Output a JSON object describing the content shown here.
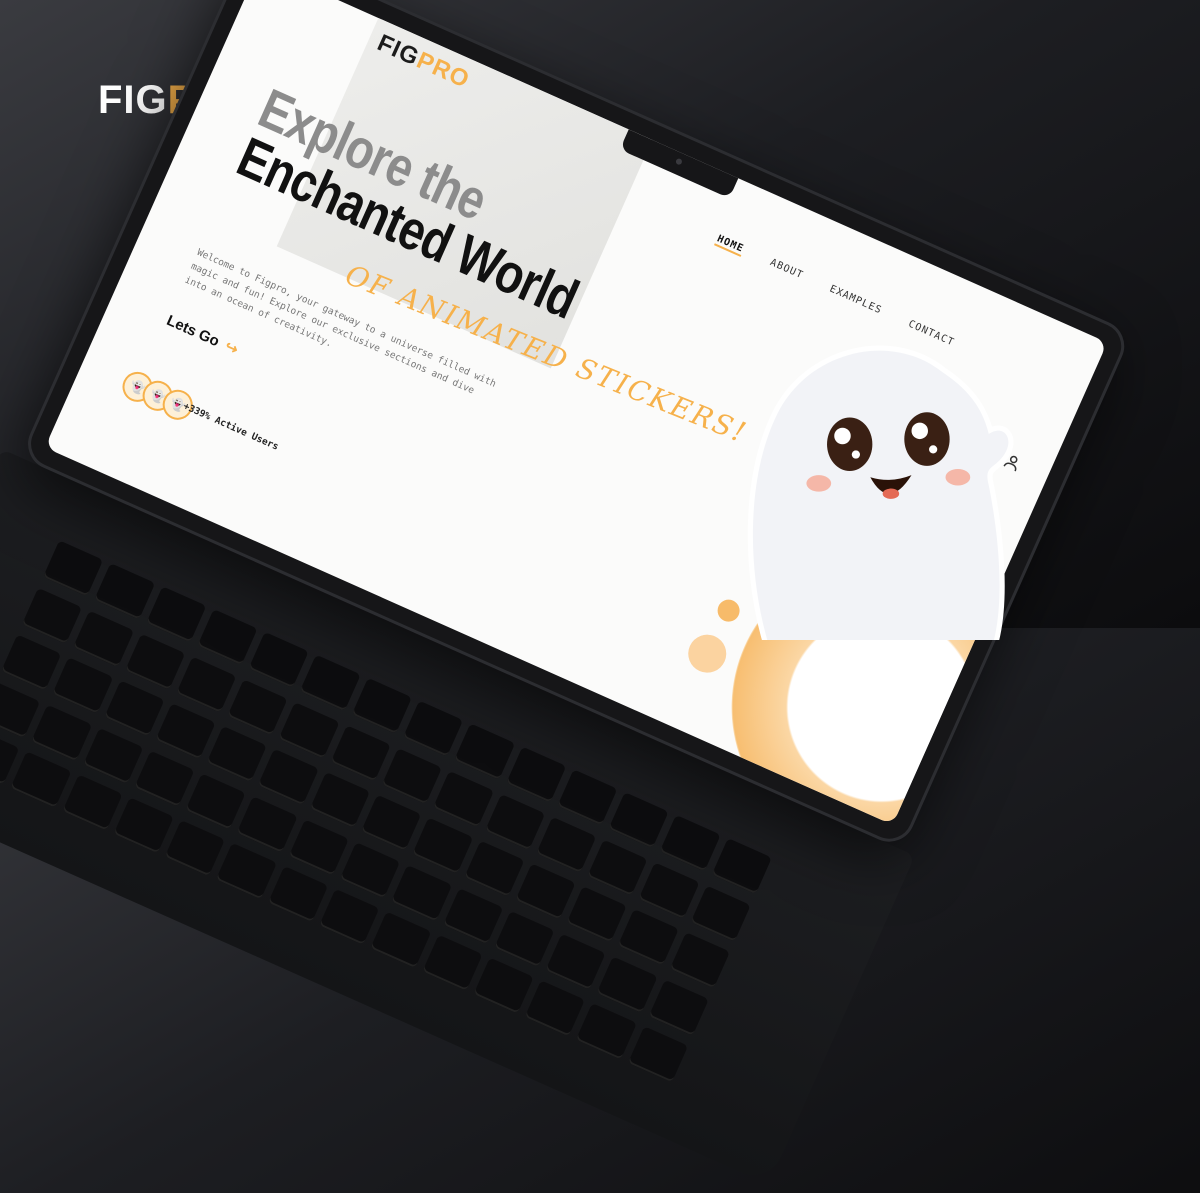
{
  "brand": {
    "fig": "FIG",
    "pro": "PRO"
  },
  "screen": {
    "logo": {
      "fig": "FIG",
      "pro": "PRO"
    },
    "nav": [
      {
        "label": "HOME",
        "active": true
      },
      {
        "label": "ABOUT",
        "active": false
      },
      {
        "label": "EXAMPLES",
        "active": false
      },
      {
        "label": "CONTACT",
        "active": false
      }
    ],
    "headline": {
      "line1": "Explore the",
      "line2": "Enchanted World"
    },
    "subtitle": "OF ANIMATED STICKERS!",
    "description": "Welcome to Figpro, your gateway to a universe filled with magic and fun! Explore our exclusive sections and dive into an ocean of creativity.",
    "cta": "Lets Go",
    "active_users": "+339% Active Users"
  },
  "colors": {
    "accent": "#f6b14b",
    "dark": "#111111"
  }
}
